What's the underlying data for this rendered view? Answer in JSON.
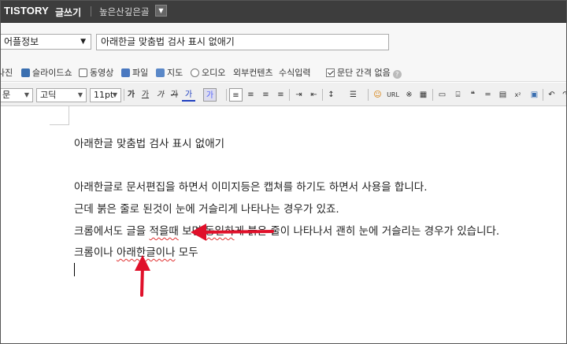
{
  "topbar": {
    "brand": "TISTORY",
    "brand_sub": "글쓰기",
    "blog_name": "높은산깊은골"
  },
  "title_row": {
    "category": "어플정보",
    "title_value": "아래한글 맞춤법 검사 표시 없애기"
  },
  "media_toolbar": {
    "items": [
      "사진",
      "슬라이드쇼",
      "동영상",
      "파일",
      "지도",
      "오디오",
      "외부컨텐츠",
      "수식입력"
    ],
    "line_spacing_label": "문단 간격 없음"
  },
  "format_toolbar": {
    "paragraph": "문",
    "font": "고딕",
    "size": "11pt",
    "buttons": [
      "가",
      "가",
      "가",
      "가",
      "가",
      "가"
    ],
    "url_label": "URL"
  },
  "editor": {
    "heading": "아래한글 맞춤법 검사 표시 없애기",
    "lines": [
      "아래한글로 문서편집을 하면서 이미지등은 캡쳐를 하기도 하면서 사용을 합니다.",
      "근데 붉은 줄로 된것이 눈에 거슬리게 나타나는 경우가 있죠."
    ],
    "line3": {
      "pre": "크롬에서도 글을 ",
      "err1": "적을때",
      "mid": " 보면 ",
      "err2": "동일하",
      "post": "게 붉은 줄이 나타나서 괜히 눈에 거슬리는 경우가 있습니다."
    },
    "line4": {
      "pre": "크롬이나 ",
      "err": "아래한글이나",
      "post": " 모두"
    }
  },
  "colors": {
    "topbar": "#3d3d3d",
    "annotation_arrow": "#e0102a",
    "spell_underline": "#e03030"
  }
}
